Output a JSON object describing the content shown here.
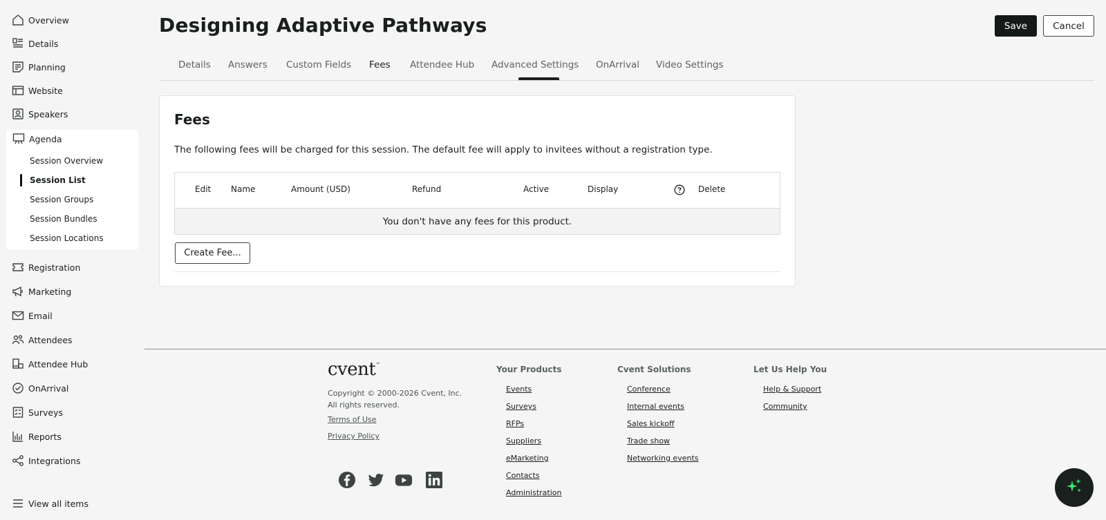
{
  "sidebar": {
    "items": [
      {
        "label": "Overview",
        "icon": "home-icon"
      },
      {
        "label": "Details",
        "icon": "details-icon"
      },
      {
        "label": "Planning",
        "icon": "planning-icon"
      },
      {
        "label": "Website",
        "icon": "website-icon"
      },
      {
        "label": "Speakers",
        "icon": "speakers-icon"
      },
      {
        "label": "Agenda",
        "icon": "agenda-icon"
      },
      {
        "label": "Registration",
        "icon": "ticket-icon"
      },
      {
        "label": "Marketing",
        "icon": "megaphone-icon"
      },
      {
        "label": "Email",
        "icon": "mail-icon"
      },
      {
        "label": "Attendees",
        "icon": "people-icon"
      },
      {
        "label": "Attendee Hub",
        "icon": "hub-icon"
      },
      {
        "label": "OnArrival",
        "icon": "check-circle-icon"
      },
      {
        "label": "Surveys",
        "icon": "survey-icon"
      },
      {
        "label": "Reports",
        "icon": "bar-chart-icon"
      },
      {
        "label": "Integrations",
        "icon": "share-icon"
      }
    ],
    "agenda_sub": [
      "Session Overview",
      "Session List",
      "Session Groups",
      "Session Bundles",
      "Session Locations"
    ],
    "active_sub": "Session List",
    "view_all": "View all items"
  },
  "header": {
    "title": "Designing Adaptive Pathways",
    "save_label": "Save",
    "cancel_label": "Cancel"
  },
  "tabs": [
    "Details",
    "Answers",
    "Custom Fields",
    "Fees",
    "Attendee Hub",
    "Advanced Settings",
    "OnArrival",
    "Video Settings"
  ],
  "active_tab": "Fees",
  "fees": {
    "title": "Fees",
    "description": "The following fees will be charged for this session. The default fee will apply to invitees without a registration type.",
    "columns": [
      "Edit",
      "Name",
      "Amount (USD)",
      "Refund",
      "Active",
      "Display",
      "Delete"
    ],
    "empty_message": "You don't have any fees for this product.",
    "create_label": "Create Fee..."
  },
  "footer": {
    "logo": "cvent",
    "logo_tm": "™",
    "copyright_line1": "Copyright © 2000-2026 Cvent, Inc.",
    "copyright_line2": "All rights reserved.",
    "terms": "Terms of Use",
    "privacy": "Privacy Policy",
    "columns": [
      {
        "heading": "Your Products",
        "links": [
          "Events",
          "Surveys",
          "RFPs",
          "Suppliers",
          "eMarketing",
          "Contacts",
          "Administration"
        ]
      },
      {
        "heading": "Cvent Solutions",
        "links": [
          "Conference",
          "Internal events",
          "Sales kickoff",
          "Trade show",
          "Networking events"
        ]
      },
      {
        "heading": "Let Us Help You",
        "links": [
          "Help & Support",
          "Community"
        ]
      }
    ],
    "social": [
      "facebook-icon",
      "twitter-icon",
      "youtube-icon",
      "linkedin-icon"
    ]
  },
  "colors": {
    "primary": "#151a18",
    "ai_accent": "#3ee07a",
    "background": "#f4f5f4"
  }
}
